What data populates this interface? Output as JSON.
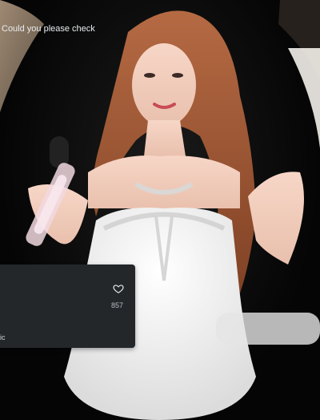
{
  "comment": {
    "text": "Could you please check",
    "like_count": "857",
    "meta_text": "ic"
  },
  "icons": {
    "like": "heart-outline-icon"
  },
  "colors": {
    "card_bg": "#24272a",
    "text": "#e9ecef",
    "muted": "#b7bcc1"
  }
}
